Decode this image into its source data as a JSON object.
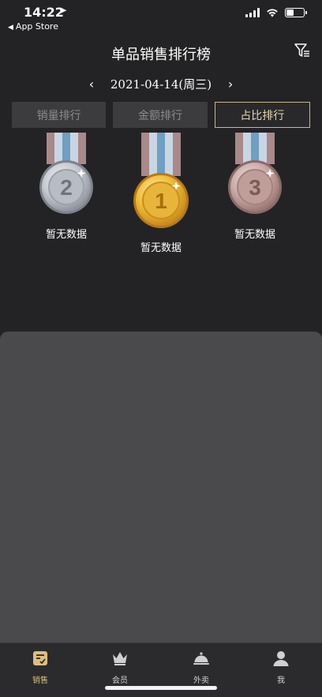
{
  "status_bar": {
    "time": "14:22",
    "location_arrow": "➤",
    "back_label": "App Store",
    "back_icon": "back-triangle-icon"
  },
  "nav": {
    "title": "单品销售排行榜",
    "filter_icon": "filter-icon"
  },
  "date": {
    "prev": "‹",
    "value": "2021-04-14(周三)",
    "next": "›"
  },
  "tabs": [
    {
      "label": "销量排行",
      "active": false
    },
    {
      "label": "金额排行",
      "active": false
    },
    {
      "label": "占比排行",
      "active": true
    }
  ],
  "medals": [
    {
      "rank": "2",
      "label": "暂无数据"
    },
    {
      "rank": "1",
      "label": "暂无数据"
    },
    {
      "rank": "3",
      "label": "暂无数据"
    }
  ],
  "tabbar": {
    "items": [
      {
        "label": "销售",
        "icon": "sales-icon",
        "active": true
      },
      {
        "label": "会员",
        "icon": "crown-icon",
        "active": false
      },
      {
        "label": "外卖",
        "icon": "cloche-icon",
        "active": false
      },
      {
        "label": "我",
        "icon": "user-icon",
        "active": false
      }
    ]
  },
  "colors": {
    "background": "#232325",
    "accent_gold": "#cdb58c",
    "active_tab_text": "#e0bd7e",
    "panel": "#4a4a4c"
  }
}
